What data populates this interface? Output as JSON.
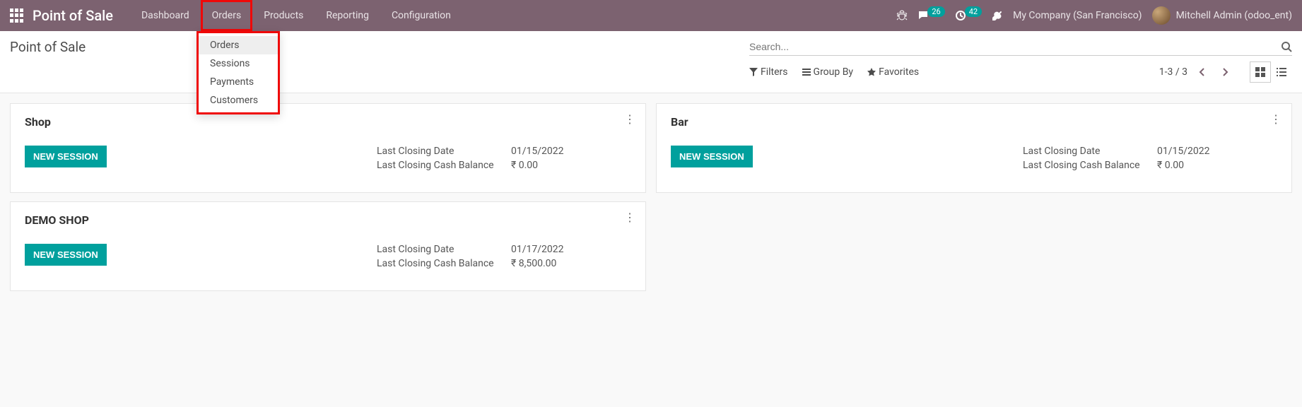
{
  "brand": "Point of Sale",
  "nav": {
    "items": [
      "Dashboard",
      "Orders",
      "Products",
      "Reporting",
      "Configuration"
    ],
    "active_index": 1
  },
  "dropdown": {
    "items": [
      "Orders",
      "Sessions",
      "Payments",
      "Customers"
    ],
    "hover_index": 0
  },
  "systray": {
    "messages_count": "26",
    "activities_count": "42",
    "company": "My Company (San Francisco)",
    "user": "Mitchell Admin (odoo_ent)"
  },
  "page_title": "Point of Sale",
  "search": {
    "placeholder": "Search..."
  },
  "controls": {
    "filters": "Filters",
    "groupby": "Group By",
    "favorites": "Favorites",
    "pager": "1-3 / 3"
  },
  "cards": {
    "shop": {
      "title": "Shop",
      "button": "NEW SESSION",
      "close_date_label": "Last Closing Date",
      "close_date_value": "01/15/2022",
      "close_bal_label": "Last Closing Cash Balance",
      "close_bal_value": "₹ 0.00"
    },
    "bar": {
      "title": "Bar",
      "button": "NEW SESSION",
      "close_date_label": "Last Closing Date",
      "close_date_value": "01/15/2022",
      "close_bal_label": "Last Closing Cash Balance",
      "close_bal_value": "₹ 0.00"
    },
    "demo": {
      "title": "DEMO SHOP",
      "button": "NEW SESSION",
      "close_date_label": "Last Closing Date",
      "close_date_value": "01/17/2022",
      "close_bal_label": "Last Closing Cash Balance",
      "close_bal_value": "₹ 8,500.00"
    }
  }
}
